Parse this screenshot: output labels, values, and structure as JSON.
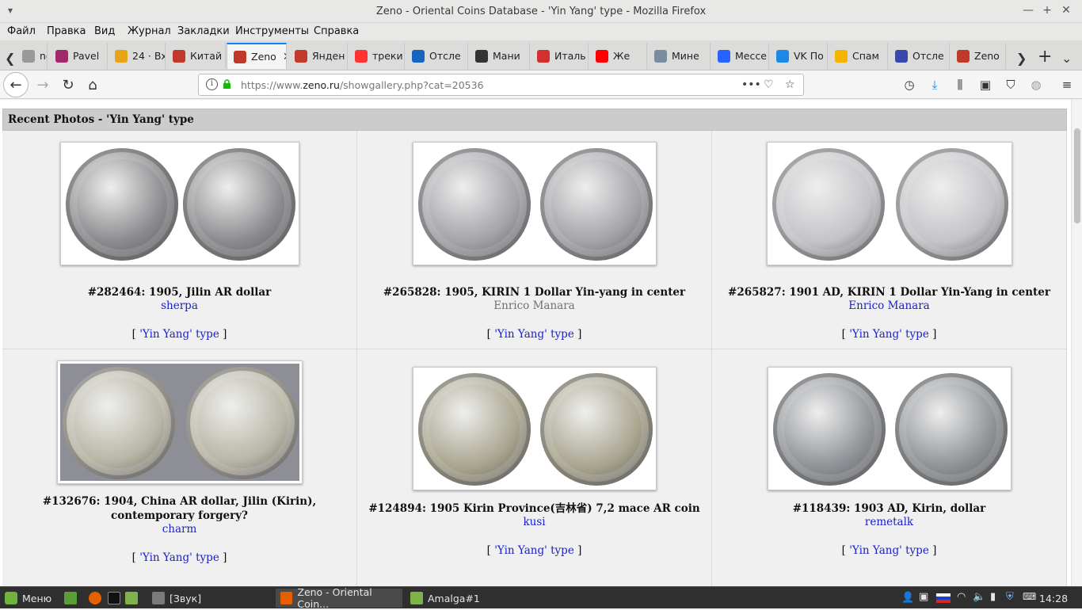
{
  "window": {
    "title": "Zeno - Oriental Coins Database - 'Yin Yang' type - Mozilla Firefox"
  },
  "menu": [
    "Файл",
    "Правка",
    "Вид",
    "Журнал",
    "Закладки",
    "Инструменты",
    "Справка"
  ],
  "tabs": [
    {
      "label": "nda",
      "color": "#999999"
    },
    {
      "label": "Pavel",
      "color": "#a0286b"
    },
    {
      "label": "24 · Вх",
      "color": "#e8a317"
    },
    {
      "label": "Китай",
      "color": "#c0392b"
    },
    {
      "label": "Zeno",
      "color": "#c0392b",
      "active": true
    },
    {
      "label": "Янден",
      "color": "#c0392b"
    },
    {
      "label": "треки",
      "color": "#ff3333"
    },
    {
      "label": "Отсле",
      "color": "#1565c0"
    },
    {
      "label": "Мани",
      "color": "#333333"
    },
    {
      "label": "Италь",
      "color": "#d32f2f"
    },
    {
      "label": "Же",
      "color": "#ff0000"
    },
    {
      "label": "Мине",
      "color": "#7a8ca0"
    },
    {
      "label": "Мессе",
      "color": "#2962ff"
    },
    {
      "label": "VK По",
      "color": "#1e88e5"
    },
    {
      "label": "Спам",
      "color": "#f4b400"
    },
    {
      "label": "Отсле",
      "color": "#3949ab"
    },
    {
      "label": "Zeno",
      "color": "#c0392b"
    }
  ],
  "urlbar": {
    "prefix": "https://www.",
    "domain": "zeno.ru",
    "path": "/showgallery.php?cat=20536"
  },
  "gallery": {
    "header": "Recent Photos - 'Yin Yang' type",
    "items": [
      {
        "caption": "#282464: 1905, Jilin AR dollar",
        "author": "sherpa",
        "author_link": true,
        "category": "'Yin Yang' type",
        "bg": "#ffffff",
        "coin": "#8b8b8e"
      },
      {
        "caption": "#265828: 1905, KIRIN 1 Dollar Yin-yang in center",
        "author": "Enrico Manara",
        "author_link": false,
        "category": "'Yin Yang' type",
        "bg": "#ffffff",
        "coin": "#a3a3a8"
      },
      {
        "caption": "#265827: 1901 AD, KIRIN 1 Dollar Yin-Yang in center",
        "author": "Enrico Manara",
        "author_link": true,
        "category": "'Yin Yang' type",
        "bg": "#ffffff",
        "coin": "#c4c4c8"
      },
      {
        "caption": "#132676: 1904, China AR dollar, Jilin (Kirin), contemporary forgery?",
        "author": "charm",
        "author_link": true,
        "category": "'Yin Yang' type",
        "bg": "#8e8e96",
        "coin": "#b9b6a6"
      },
      {
        "caption": "#124894: 1905 Kirin Province(吉林省) 7,2 mace AR coin",
        "author": "kusi",
        "author_link": true,
        "category": "'Yin Yang' type",
        "bg": "#ffffff",
        "coin": "#a9a58f"
      },
      {
        "caption": "#118439: 1903 AD, Kirin, dollar",
        "author": "remetalk",
        "author_link": true,
        "category": "'Yin Yang' type",
        "bg": "#ffffff",
        "coin": "#8f9296"
      }
    ]
  },
  "taskbar": {
    "menu_label": "Меню",
    "windows": [
      {
        "label": "[Звук]",
        "active": false
      },
      {
        "label": "Zeno - Oriental Coin...",
        "active": true
      },
      {
        "label": "Amalga#1",
        "active": false
      }
    ],
    "clock": "14:28"
  }
}
